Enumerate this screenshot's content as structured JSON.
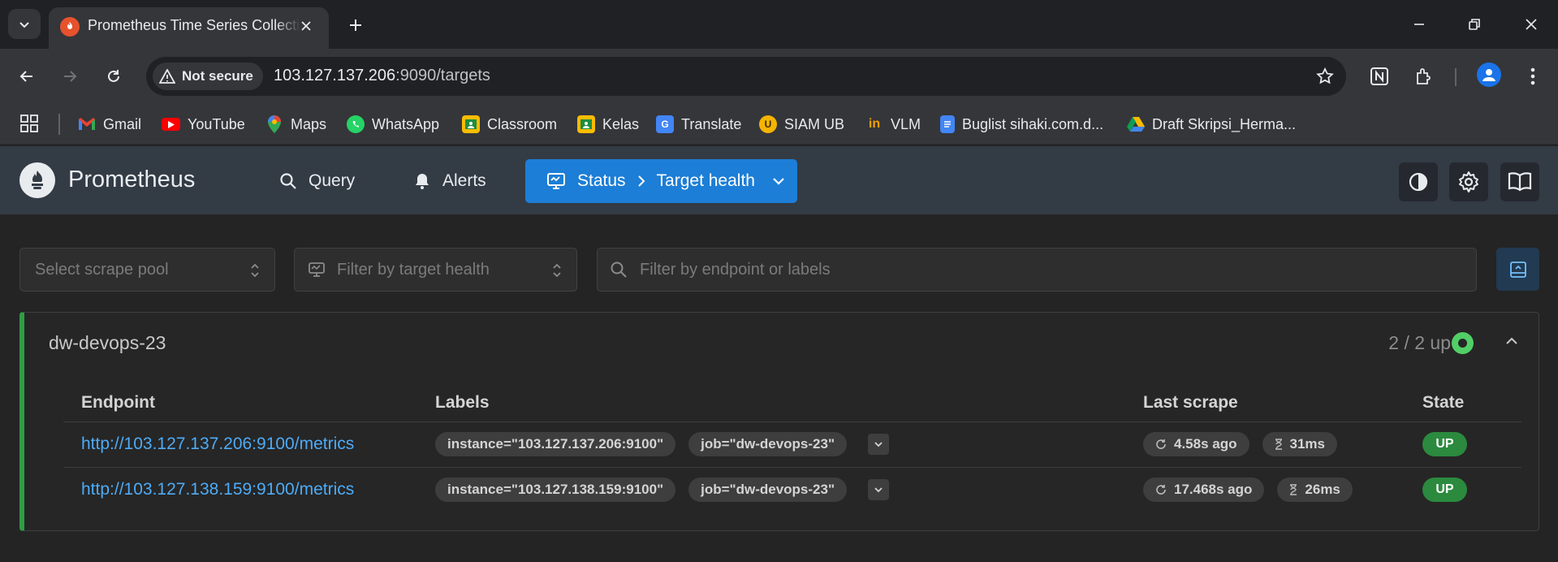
{
  "browser": {
    "tab": {
      "title": "Prometheus Time Series Collection and Processing Server"
    },
    "address": {
      "security_label": "Not secure",
      "url_host": "103.127.137.206",
      "url_rest": ":9090/targets"
    },
    "bookmarks": [
      {
        "label": "Gmail",
        "icon": "gmail-icon"
      },
      {
        "label": "YouTube",
        "icon": "youtube-icon"
      },
      {
        "label": "Maps",
        "icon": "maps-icon"
      },
      {
        "label": "WhatsApp",
        "icon": "whatsapp-icon"
      },
      {
        "label": "Classroom",
        "icon": "classroom-icon"
      },
      {
        "label": "Kelas",
        "icon": "kelas-icon"
      },
      {
        "label": "Translate",
        "icon": "translate-icon"
      },
      {
        "label": "SIAM UB",
        "icon": "siam-icon"
      },
      {
        "label": "VLM",
        "icon": "vlm-icon"
      },
      {
        "label": "Buglist sihaki.com.d...",
        "icon": "docs-icon"
      },
      {
        "label": "Draft Skripsi_Herma...",
        "icon": "drive-icon"
      }
    ]
  },
  "app": {
    "brand": "Prometheus",
    "nav": {
      "query": "Query",
      "alerts": "Alerts",
      "status": "Status",
      "target_health": "Target health"
    }
  },
  "filters": {
    "scrape_pool_placeholder": "Select scrape pool",
    "health_placeholder": "Filter by target health",
    "search_placeholder": "Filter by endpoint or labels"
  },
  "pool": {
    "name": "dw-devops-23",
    "up_count": "2 / 2 up",
    "columns": {
      "endpoint": "Endpoint",
      "labels": "Labels",
      "last_scrape": "Last scrape",
      "state": "State"
    },
    "targets": [
      {
        "endpoint": "http://103.127.137.206:9100/metrics",
        "label_instance": "instance=\"103.127.137.206:9100\"",
        "label_job": "job=\"dw-devops-23\"",
        "last_scrape": "4.58s ago",
        "duration": "31ms",
        "state": "UP"
      },
      {
        "endpoint": "http://103.127.138.159:9100/metrics",
        "label_instance": "instance=\"103.127.138.159:9100\"",
        "label_job": "job=\"dw-devops-23\"",
        "last_scrape": "17.468s ago",
        "duration": "26ms",
        "state": "UP"
      }
    ]
  },
  "colors": {
    "accent": "#1c7ed6",
    "up": "#2b8a3e",
    "healthy_dot": "#51cf66",
    "link": "#4dabf7"
  }
}
